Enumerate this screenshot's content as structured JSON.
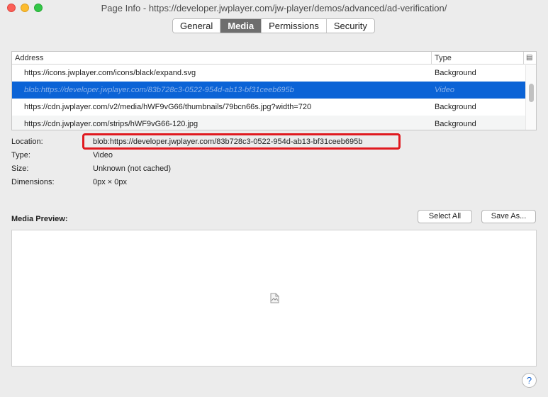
{
  "window": {
    "title": "Page Info - https://developer.jwplayer.com/jw-player/demos/advanced/ad-verification/"
  },
  "tabs": [
    {
      "label": "General",
      "active": false
    },
    {
      "label": "Media",
      "active": true
    },
    {
      "label": "Permissions",
      "active": false
    },
    {
      "label": "Security",
      "active": false
    }
  ],
  "media_list": {
    "columns": {
      "address": "Address",
      "type": "Type"
    },
    "rows": [
      {
        "address": "https://icons.jwplayer.com/icons/black/expand.svg",
        "type": "Background"
      },
      {
        "address": "blob:https://developer.jwplayer.com/83b728c3-0522-954d-ab13-bf31ceeb695b",
        "type": "Video"
      },
      {
        "address": "https://cdn.jwplayer.com/v2/media/hWF9vG66/thumbnails/79bcn66s.jpg?width=720",
        "type": "Background"
      },
      {
        "address": "https://cdn.jwplayer.com/strips/hWF9vG66-120.jpg",
        "type": "Background"
      }
    ]
  },
  "details": {
    "location_label": "Location:",
    "location_value": "blob:https://developer.jwplayer.com/83b728c3-0522-954d-ab13-bf31ceeb695b",
    "type_label": "Type:",
    "type_value": "Video",
    "size_label": "Size:",
    "size_value": "Unknown (not cached)",
    "dimensions_label": "Dimensions:",
    "dimensions_value": "0px × 0px"
  },
  "preview": {
    "label": "Media Preview:",
    "select_all": "Select All",
    "save_as": "Save As..."
  },
  "help_label": "?",
  "colors": {
    "selection": "#0b63d6",
    "highlight_border": "#e0191f"
  }
}
